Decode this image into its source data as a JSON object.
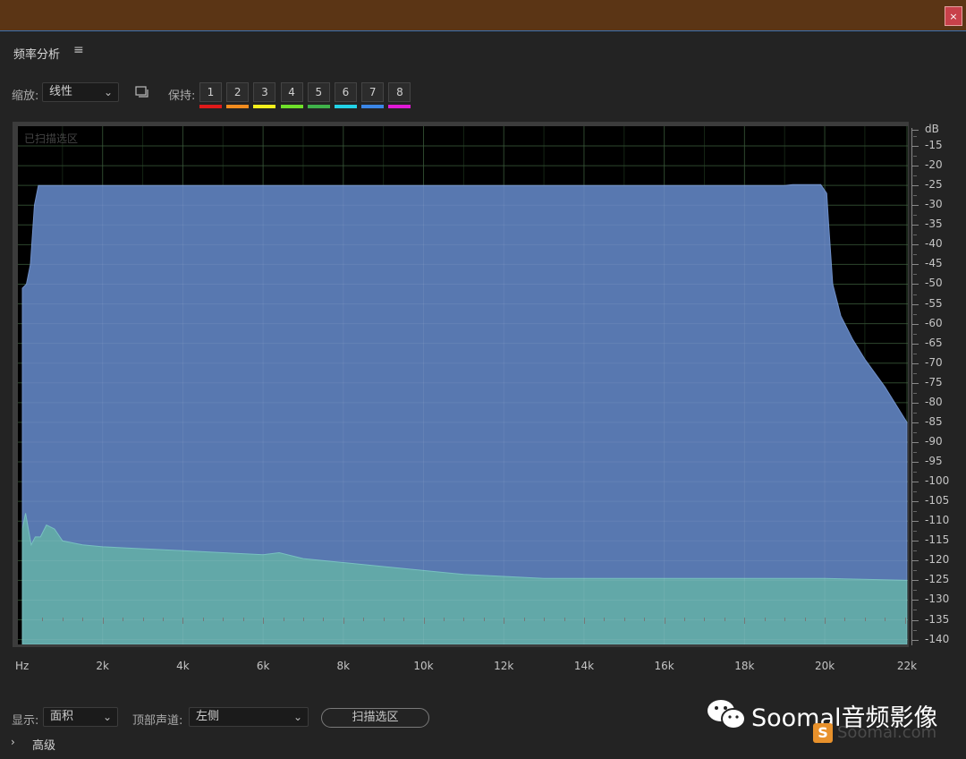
{
  "window": {
    "close_label": "×"
  },
  "panel": {
    "title": "频率分析",
    "menu_icon": "hamburger-menu-icon",
    "menu_glyph": "≡"
  },
  "toolbar": {
    "zoom_label": "缩放:",
    "zoom_value": "线性",
    "hold_label": "保持:",
    "hold_slots": [
      {
        "label": "1",
        "color": "#e01a1a"
      },
      {
        "label": "2",
        "color": "#f28c1e"
      },
      {
        "label": "3",
        "color": "#f4f01c"
      },
      {
        "label": "4",
        "color": "#6fe02a"
      },
      {
        "label": "5",
        "color": "#3fb24a"
      },
      {
        "label": "6",
        "color": "#22d2e6"
      },
      {
        "label": "7",
        "color": "#3b86e6"
      },
      {
        "label": "8",
        "color": "#e01ad6"
      }
    ]
  },
  "plot": {
    "overlay_text": "已扫描选区",
    "y_unit": "dB",
    "x_unit": "Hz"
  },
  "chart_data": {
    "type": "area",
    "xlabel": "Hz",
    "ylabel": "dB",
    "xlim": [
      0,
      22050
    ],
    "ylim": [
      -140,
      -10
    ],
    "x_ticks": [
      {
        "value": 2000,
        "label": "2k"
      },
      {
        "value": 4000,
        "label": "4k"
      },
      {
        "value": 6000,
        "label": "6k"
      },
      {
        "value": 8000,
        "label": "8k"
      },
      {
        "value": 10000,
        "label": "10k"
      },
      {
        "value": 12000,
        "label": "12k"
      },
      {
        "value": 14000,
        "label": "14k"
      },
      {
        "value": 16000,
        "label": "16k"
      },
      {
        "value": 18000,
        "label": "18k"
      },
      {
        "value": 20000,
        "label": "20k"
      },
      {
        "value": 22050,
        "label": "22k"
      }
    ],
    "y_ticks": [
      -15,
      -20,
      -25,
      -30,
      -35,
      -40,
      -45,
      -50,
      -55,
      -60,
      -65,
      -70,
      -75,
      -80,
      -85,
      -90,
      -95,
      -100,
      -105,
      -110,
      -115,
      -120,
      -125,
      -130,
      -135,
      -140
    ],
    "series": [
      {
        "color": "#5878b0",
        "points": [
          [
            0,
            -51
          ],
          [
            100,
            -50
          ],
          [
            200,
            -45
          ],
          [
            300,
            -30
          ],
          [
            400,
            -25
          ],
          [
            1000,
            -25
          ],
          [
            5000,
            -25
          ],
          [
            10000,
            -25
          ],
          [
            15000,
            -25
          ],
          [
            19000,
            -25
          ],
          [
            19200,
            -24.8
          ],
          [
            19900,
            -24.8
          ],
          [
            20050,
            -27
          ],
          [
            20100,
            -35
          ],
          [
            20200,
            -50
          ],
          [
            20400,
            -58
          ],
          [
            20700,
            -64
          ],
          [
            21000,
            -69
          ],
          [
            21500,
            -76
          ],
          [
            22050,
            -85
          ]
        ]
      },
      {
        "color": "#62a8a8",
        "points": [
          [
            0,
            -112
          ],
          [
            80,
            -108
          ],
          [
            150,
            -112
          ],
          [
            220,
            -116
          ],
          [
            320,
            -114
          ],
          [
            450,
            -114
          ],
          [
            600,
            -111
          ],
          [
            800,
            -112
          ],
          [
            1000,
            -115
          ],
          [
            1500,
            -116
          ],
          [
            2000,
            -116.5
          ],
          [
            3000,
            -117
          ],
          [
            4000,
            -117.5
          ],
          [
            5000,
            -118
          ],
          [
            6000,
            -118.5
          ],
          [
            6400,
            -118
          ],
          [
            7000,
            -119.5
          ],
          [
            8000,
            -120.5
          ],
          [
            9000,
            -121.5
          ],
          [
            10000,
            -122.5
          ],
          [
            11000,
            -123.5
          ],
          [
            12000,
            -124
          ],
          [
            13000,
            -124.5
          ],
          [
            14000,
            -124.5
          ],
          [
            16000,
            -124.5
          ],
          [
            18000,
            -124.5
          ],
          [
            20000,
            -124.5
          ],
          [
            22050,
            -125
          ]
        ]
      }
    ],
    "grid": true
  },
  "bottom": {
    "display_label": "显示:",
    "display_value": "面积",
    "channel_label": "顶部声道:",
    "channel_value": "左侧",
    "scan_button": "扫描选区",
    "advanced_label": "高级"
  },
  "watermark": {
    "text": "Soomal音频影像",
    "sub": "Soomal.com",
    "logo_letter": "S"
  }
}
